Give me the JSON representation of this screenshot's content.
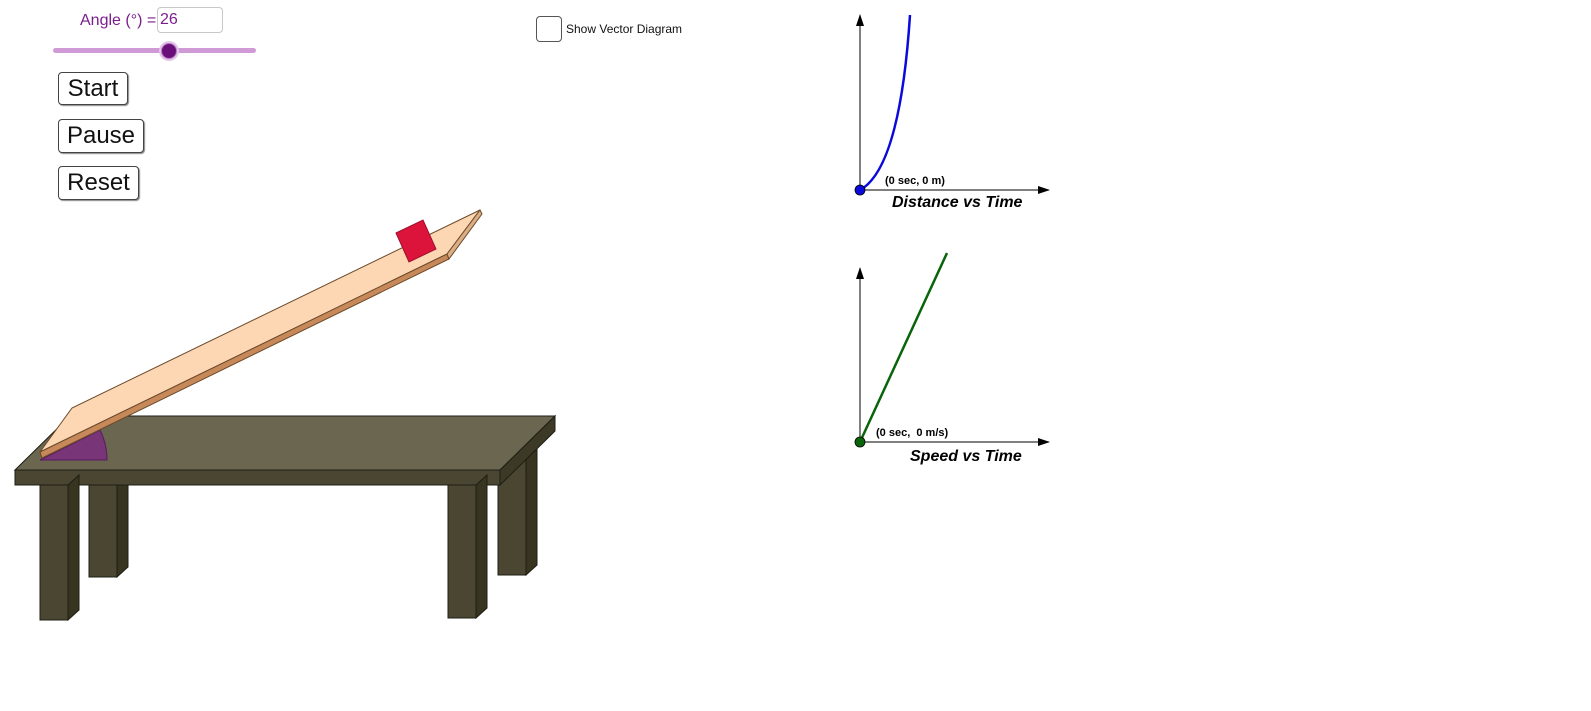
{
  "controls": {
    "angle_label": "Angle (°) =",
    "angle_value": "26",
    "angle_slider_fraction": 0.57,
    "start_label": "Start",
    "pause_label": "Pause",
    "reset_label": "Reset",
    "vector_checkbox_label": "Show Vector Diagram",
    "vector_checkbox_checked": false
  },
  "graphs": {
    "distance": {
      "title": "Distance vs Time",
      "point_label": "(0 sec, 0 m)",
      "curve_color": "#0a0adc"
    },
    "speed": {
      "title": "Speed vs Time",
      "point_label": "(0 sec,  0 m/s)",
      "line_color": "#0a640a"
    }
  },
  "scene": {
    "table_color": "#6b6650",
    "ramp_color": "#fdd7b4",
    "block_color": "#dc143c",
    "angle_marker_color": "#7a2d7f"
  }
}
